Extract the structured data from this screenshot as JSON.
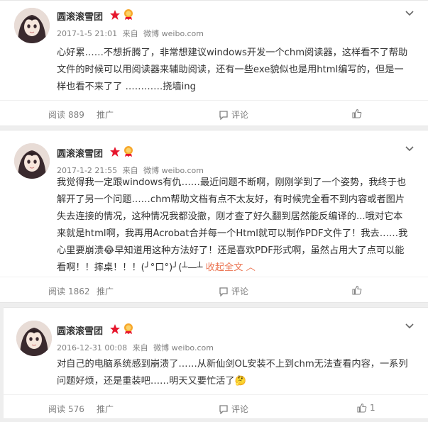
{
  "posts": [
    {
      "author": "圆滚滚雪团",
      "time": "2017-1-5 21:01",
      "source_prefix": "来自",
      "source": "微博 weibo.com",
      "text": "心好累……不想折腾了，非常想建议windows开发一个chm阅读器，这样看不了帮助文件的时候可以用阅读器来辅助阅读，还有一些exe貌似也是用html编写的，但是一样也看不来了了 …………挠墙ing",
      "read_label": "阅读",
      "read_count": "889",
      "promote": "推广",
      "comment": "评论",
      "like_count": ""
    },
    {
      "author": "圆滚滚雪团",
      "time": "2017-1-2 21:55",
      "source_prefix": "来自",
      "source": "微博 weibo.com",
      "text": "我觉得我一定跟windows有仇……最近问题不断啊，刚刚学到了一个姿势，我终于也解开了另一个问题……chm帮助文档有点不太友好，有时候完全看不到内容或者图片失去连接的情况，这种情况我都没撤，刚才查了好久翻到居然能反编译的...哦对它本来就是html啊，我再用Acrobat合并每一个Html就可以制作PDF文件了！我去……我心里要崩溃😂早知道用这种方法好了！还是喜欢PDF形式啊，虽然占用大了点可以能看啊！！摔桌！！！(╯°口°)╯(┴—┴",
      "collapse_label": "收起全文",
      "collapse_arrow": "︿",
      "read_label": "阅读",
      "read_count": "1862",
      "promote": "推广",
      "comment": "评论",
      "like_count": ""
    },
    {
      "author": "圆滚滚雪团",
      "time": "2016-12-31 00:08",
      "source_prefix": "来自",
      "source": "微博 weibo.com",
      "text": "对自己的电脑系统感到崩溃了……从新仙剑OL安装不上到chm无法查看内容，一系列问题好烦，还是重装吧……明天又要忙活了🤔",
      "read_label": "阅读",
      "read_count": "576",
      "promote": "推广",
      "comment": "评论",
      "like_count": "1"
    }
  ],
  "colors": {
    "accent": "#eb7350",
    "muted": "#808080",
    "text": "#333333"
  },
  "icons": {
    "comment": "comment-icon",
    "like": "thumbs-up-icon",
    "menu": "chevron-down-icon"
  }
}
